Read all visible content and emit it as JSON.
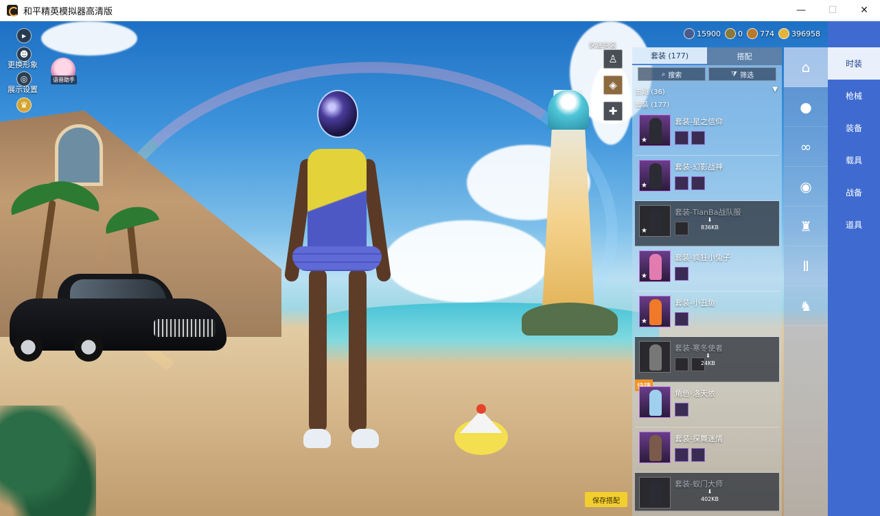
{
  "window": {
    "title": "和平精英模拟器高清版",
    "minimize": "—",
    "maximize": "☐",
    "close": "✕"
  },
  "hud": {
    "change_appearance": "更换形象",
    "display_settings": "展示设置",
    "assistant": "语音助手"
  },
  "currency": [
    {
      "value": "15900",
      "color": "#4a5a8a",
      "icon": "gem-icon"
    },
    {
      "value": "0",
      "color": "#8a7a3a",
      "icon": "coin-icon"
    },
    {
      "value": "774",
      "color": "#b87a2a",
      "icon": "token-icon"
    },
    {
      "value": "396958",
      "color": "#e2b53a",
      "icon": "gold-icon"
    }
  ],
  "close_icon": "✕",
  "quick_change": "快速换装",
  "outfit_panel": {
    "tabs": [
      {
        "label": "套装 (177)",
        "active": true
      },
      {
        "label": "搭配",
        "active": false
      }
    ],
    "search_label": "搜索",
    "filter_label": "筛选",
    "theme_label": "主题 (36)",
    "set_label": "套装 (177)",
    "items": [
      {
        "name": "套装-星之信仰",
        "subs": 2,
        "dark": false
      },
      {
        "name": "套装-幻影战神",
        "subs": 2,
        "dark": false
      },
      {
        "name": "套装-TianBa战队服",
        "subs": 1,
        "dark": true,
        "size": "836KB"
      },
      {
        "name": "套装-疯狂小兔子",
        "subs": 1,
        "dark": false
      },
      {
        "name": "套装-小丑鱼",
        "subs": 1,
        "dark": false
      },
      {
        "name": "套装-寒冬使者",
        "subs": 2,
        "dark": true,
        "size": "24KB"
      },
      {
        "name": "角色-洛天依",
        "subs": 1,
        "dark": false,
        "badge": "快捷"
      },
      {
        "name": "套装-探舞迷情",
        "subs": 2,
        "dark": false
      },
      {
        "name": "套装-蚁门大师",
        "subs": 1,
        "dark": true,
        "size": "402KB"
      }
    ]
  },
  "categories": [
    {
      "icon": "hanger-icon",
      "glyph": "⌂",
      "active": true
    },
    {
      "icon": "helmet-icon",
      "glyph": "●",
      "active": false
    },
    {
      "icon": "glasses-icon",
      "glyph": "∞",
      "active": false
    },
    {
      "icon": "mask-icon",
      "glyph": "◉",
      "active": false
    },
    {
      "icon": "top-icon",
      "glyph": "♜",
      "active": false
    },
    {
      "icon": "pants-icon",
      "glyph": "Ⅱ",
      "active": false
    },
    {
      "icon": "shoes-icon",
      "glyph": "♞",
      "active": false
    }
  ],
  "right_menu": [
    {
      "label": "时装",
      "active": true
    },
    {
      "label": "枪械",
      "active": false
    },
    {
      "label": "装备",
      "active": false
    },
    {
      "label": "载具",
      "active": false
    },
    {
      "label": "战备",
      "active": false
    },
    {
      "label": "道具",
      "active": false
    }
  ],
  "save_button": "保存搭配"
}
